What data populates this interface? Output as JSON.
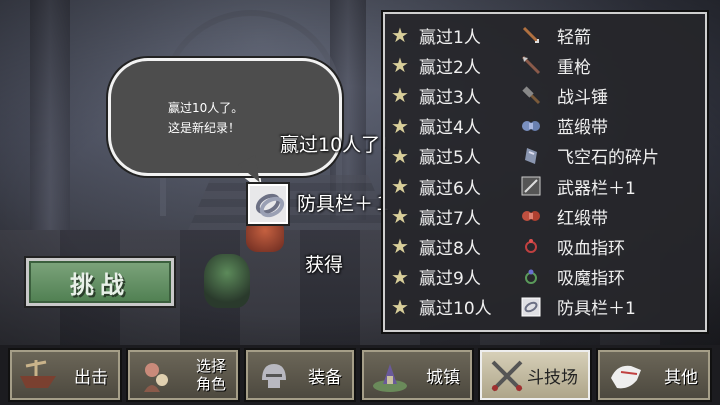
{
  "bubble": {
    "line1": "赢过10人了。",
    "line2": "这是新纪录！"
  },
  "announcement": "赢过10人了！",
  "reward": {
    "label": "防具栏＋１",
    "icon": "ring-icon"
  },
  "obtained_label": "获得",
  "challenge_button": "挑战",
  "reward_list": [
    {
      "condition": "赢过1人",
      "item": "轻箭",
      "icon": "arrow-icon"
    },
    {
      "condition": "赢过2人",
      "item": "重枪",
      "icon": "spear-icon"
    },
    {
      "condition": "赢过3人",
      "item": "战斗锤",
      "icon": "hammer-icon"
    },
    {
      "condition": "赢过4人",
      "item": "蓝缎带",
      "icon": "blue-ribbon-icon"
    },
    {
      "condition": "赢过5人",
      "item": "飞空石的碎片",
      "icon": "stone-shard-icon"
    },
    {
      "condition": "赢过6人",
      "item": "武器栏＋1",
      "icon": "weapon-slot-icon"
    },
    {
      "condition": "赢过7人",
      "item": "红缎带",
      "icon": "red-ribbon-icon"
    },
    {
      "condition": "赢过8人",
      "item": "吸血指环",
      "icon": "vampire-ring-icon"
    },
    {
      "condition": "赢过9人",
      "item": "吸魔指环",
      "icon": "mana-ring-icon"
    },
    {
      "condition": "赢过10人",
      "item": "防具栏＋1",
      "icon": "armor-slot-icon"
    }
  ],
  "menu": {
    "sortie": "出击",
    "select_line1": "选择",
    "select_line2": "角色",
    "equip": "装备",
    "town": "城镇",
    "arena": "斗技场",
    "other": "其他"
  },
  "colors": {
    "star": "#d9cf9a",
    "challenge": "#5f8f60",
    "panel": "#26262a"
  }
}
